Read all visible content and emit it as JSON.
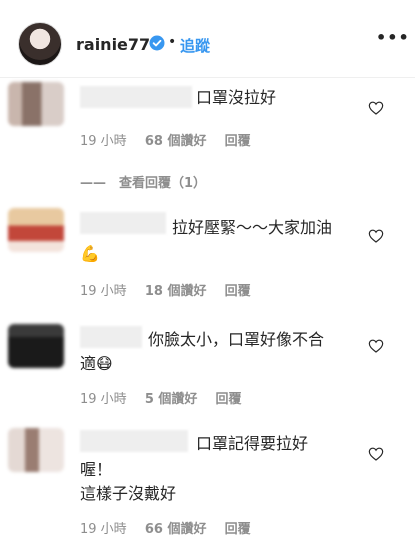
{
  "header": {
    "username": "rainie77",
    "dot": "•",
    "follow_label": "追蹤",
    "more_label": "•••"
  },
  "comments": [
    {
      "text_lines": [
        "口罩沒拉好"
      ],
      "time": "19 小時",
      "likes": "68 個讚好",
      "reply": "回覆"
    },
    {
      "text_lines": [
        "拉好壓緊～～大家加油",
        "💪"
      ],
      "time": "19 小時",
      "likes": "18 個讚好",
      "reply": "回覆"
    },
    {
      "text_lines": [
        "你臉太小，口罩好像不合",
        "適😷"
      ],
      "time": "19 小時",
      "likes": "5 個讚好",
      "reply": "回覆"
    },
    {
      "text_lines": [
        "口罩記得要拉好",
        "喔！",
        "這樣子沒戴好"
      ],
      "time": "19 小時",
      "likes": "66 個讚好",
      "reply": "回覆"
    }
  ],
  "view_replies_label": "——　查看回覆（1）",
  "colors": {
    "accent": "#3897f0",
    "verified": "#3897f0",
    "meta": "#8e8e8e"
  },
  "icons": [
    "verified-badge-icon",
    "heart-icon",
    "more-icon"
  ]
}
